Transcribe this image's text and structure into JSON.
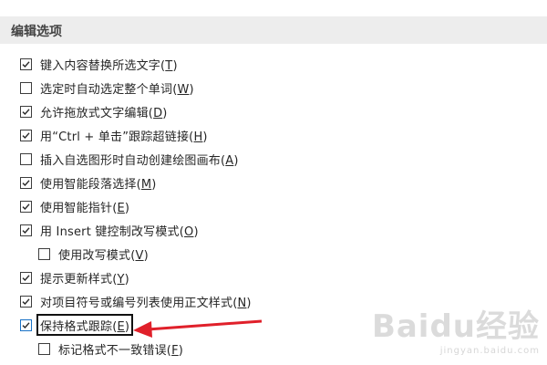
{
  "section": {
    "title": "编辑选项"
  },
  "options": [
    {
      "label": "键入内容替换所选文字",
      "key": "T",
      "checked": true
    },
    {
      "label": "选定时自动选定整个单词",
      "key": "W",
      "checked": false
    },
    {
      "label": "允许拖放式文字编辑",
      "key": "D",
      "checked": true
    },
    {
      "label": "用“Ctrl + 单击”跟踪超链接",
      "key": "H",
      "checked": true
    },
    {
      "label": "插入自选图形时自动创建绘图画布",
      "key": "A",
      "checked": false
    },
    {
      "label": "使用智能段落选择",
      "key": "M",
      "checked": true
    },
    {
      "label": "使用智能指针",
      "key": "E",
      "checked": true
    },
    {
      "label": "用 Insert 键控制改写模式",
      "key": "O",
      "checked": true
    },
    {
      "label": "使用改写模式",
      "key": "V",
      "checked": false
    },
    {
      "label": "提示更新样式",
      "key": "Y",
      "checked": true
    },
    {
      "label": "对项目符号或编号列表使用正文样式",
      "key": "N",
      "checked": true
    },
    {
      "label": "保持格式跟踪",
      "key": "E",
      "checked": true,
      "highlighted": true
    },
    {
      "label": "标记格式不一致错误",
      "key": "F",
      "checked": false
    }
  ],
  "watermark": {
    "brand": "Baidu经验",
    "sub": "jingyan.baidu.com"
  },
  "colors": {
    "arrow": "#e0202a",
    "header_bg": "#ededed",
    "focus_border": "#1a73c7"
  }
}
